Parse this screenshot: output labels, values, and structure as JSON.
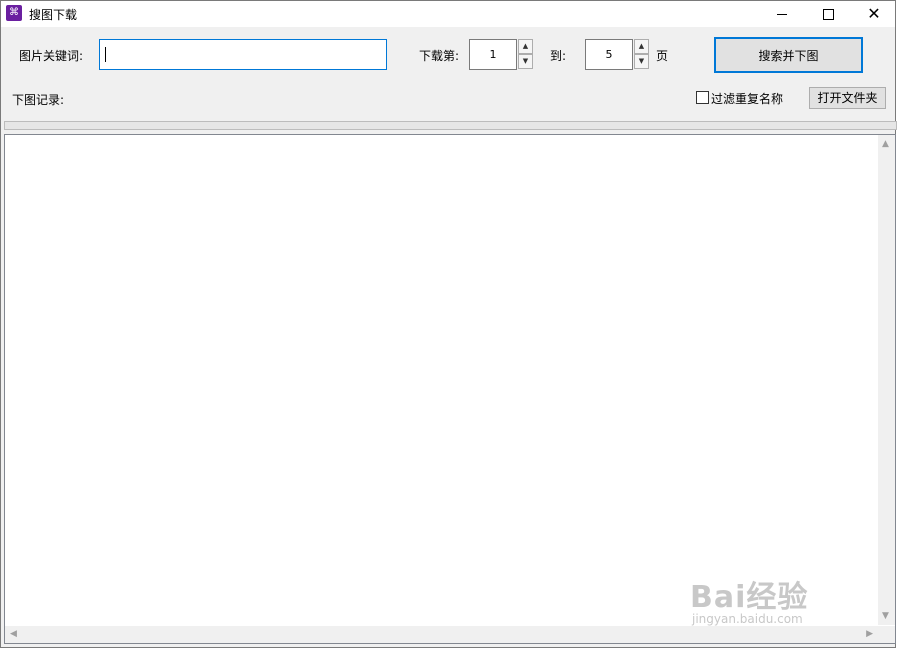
{
  "window": {
    "title": "搜图下载"
  },
  "form": {
    "keyword_label": "图片关键词:",
    "keyword_value": "",
    "download_from_label": "下载第:",
    "from_page": "1",
    "to_label": "到:",
    "to_page": "5",
    "page_unit": "页",
    "search_button": "搜索并下图",
    "log_label": "下图记录:",
    "filter_label": "过滤重复名称",
    "filter_checked": false,
    "open_folder_button": "打开文件夹"
  },
  "watermark": {
    "logo": "Bai经验",
    "url": "jingyan.baidu.com"
  },
  "colors": {
    "focus_border": "#0078d7",
    "window_bg": "#f0f0f0",
    "app_icon": "#6a1fa0"
  },
  "icons": [
    "app-icon",
    "minimize-icon",
    "maximize-icon",
    "close-icon",
    "spin-up-icon",
    "spin-down-icon",
    "checkbox-icon"
  ]
}
